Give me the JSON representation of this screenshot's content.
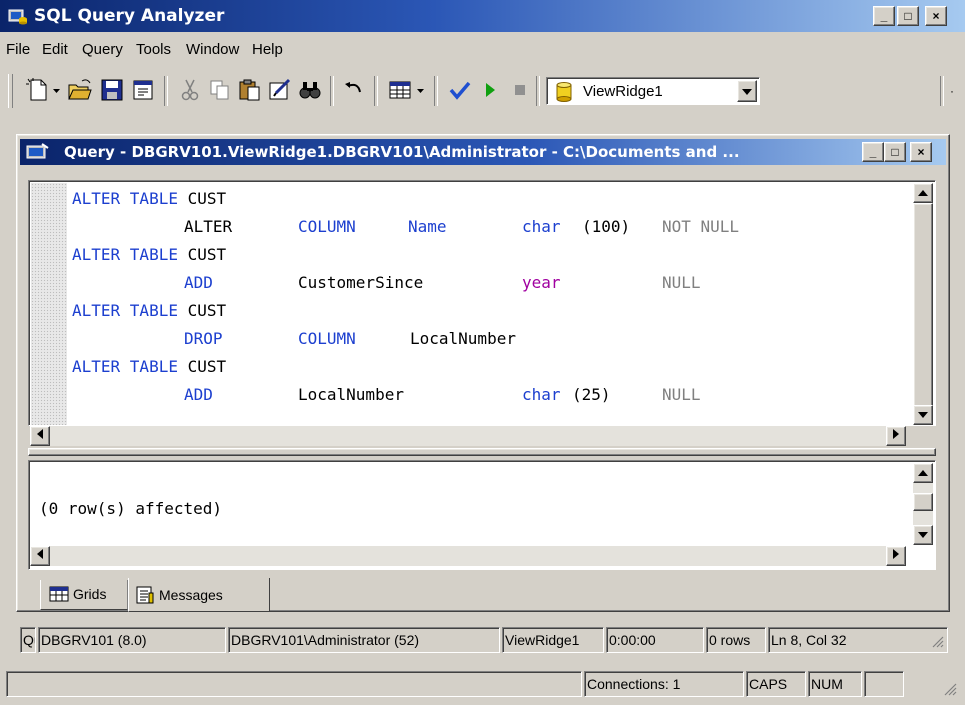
{
  "window": {
    "title": "SQL Query Analyzer"
  },
  "title_buttons": {
    "minimize": "_",
    "maximize": "□",
    "close": "×"
  },
  "menu": [
    "File",
    "Edit",
    "Query",
    "Tools",
    "Window",
    "Help"
  ],
  "toolbar": {
    "database": "ViewRidge1",
    "icons": [
      "new-query-icon",
      "open-icon",
      "save-icon",
      "load-script-icon",
      "cut-icon",
      "copy-icon",
      "paste-icon",
      "clear-icon",
      "find-icon",
      "undo-icon",
      "results-mode-icon",
      "parse-icon",
      "execute-icon",
      "stop-icon",
      "database-icon"
    ]
  },
  "query_window": {
    "title": "Query - DBGRV101.ViewRidge1.DBGRV101\\Administrator - C:\\Documents and ...",
    "code": {
      "l1": {
        "a": "ALTER TABLE",
        "b": " CUST"
      },
      "l2": {
        "a": "ALTER",
        "b": "COLUMN",
        "c": "Name",
        "d": "char",
        "e": "(100)",
        "f": "NOT NULL"
      },
      "l3": {
        "a": "ALTER TABLE",
        "b": " CUST"
      },
      "l4": {
        "a": "ADD",
        "b": "CustomerSince",
        "c": "year",
        "d": "NULL"
      },
      "l5": {
        "a": "ALTER TABLE",
        "b": " CUST"
      },
      "l6": {
        "a": "DROP",
        "b": "COLUMN",
        "c": "LocalNumber"
      },
      "l7": {
        "a": "ALTER TABLE",
        "b": " CUST"
      },
      "l8": {
        "a": "ADD",
        "b": "LocalNumber",
        "c": "char",
        "d": "(25)",
        "e": "NULL"
      }
    },
    "message": "(0 row(s) affected)",
    "tabs": {
      "grids": "Grids",
      "messages": "Messages"
    },
    "status": {
      "q": "Qu",
      "server": "DBGRV101 (8.0)",
      "user": "DBGRV101\\Administrator (52)",
      "db": "ViewRidge1",
      "time": "0:00:00",
      "rows": "0 rows",
      "pos": "Ln 8, Col 32"
    }
  },
  "statusbar": {
    "connections": "Connections: 1",
    "caps": "CAPS",
    "num": "NUM"
  },
  "colors": {
    "title_active": "#0a246a",
    "keyword": "#1c3fcf",
    "type_year": "#a000a0",
    "gray_text": "#808080"
  }
}
